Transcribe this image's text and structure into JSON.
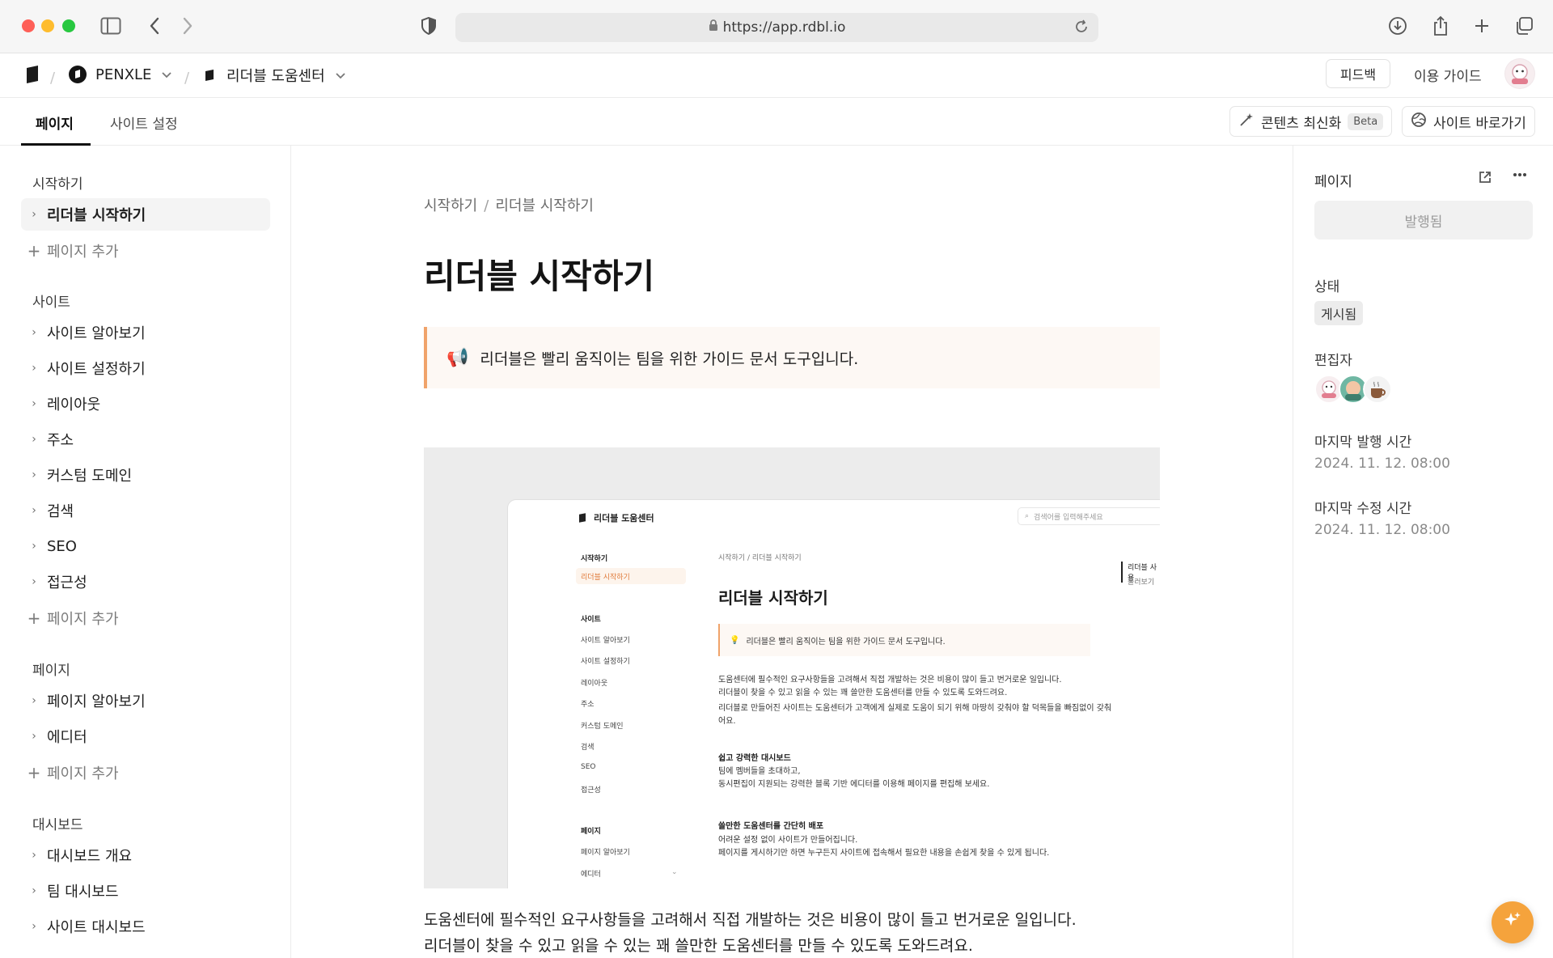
{
  "browser": {
    "url": "https://app.rdbl.io"
  },
  "appbar": {
    "workspace": "PENXLE",
    "site": "리더블 도움센터",
    "feedback_label": "피드백",
    "guide_label": "이용 가이드"
  },
  "tabs": [
    {
      "label": "페이지",
      "active": true
    },
    {
      "label": "사이트 설정",
      "active": false
    }
  ],
  "toolbar": {
    "refresh_label": "콘텐츠 최신화",
    "beta_label": "Beta",
    "visit_label": "사이트 바로가기"
  },
  "sidebar": {
    "sections": [
      {
        "title": "시작하기",
        "items": [
          "리더블 시작하기"
        ],
        "add_label": "페이지 추가"
      },
      {
        "title": "사이트",
        "items": [
          "사이트 알아보기",
          "사이트 설정하기",
          "레이아웃",
          "주소",
          "커스텀 도메인",
          "검색",
          "SEO",
          "접근성"
        ],
        "add_label": "페이지 추가"
      },
      {
        "title": "페이지",
        "items": [
          "페이지 알아보기",
          "에디터"
        ],
        "add_label": "페이지 추가"
      },
      {
        "title": "대시보드",
        "items": [
          "대시보드 개요",
          "팀 대시보드",
          "사이트 대시보드"
        ]
      }
    ]
  },
  "main": {
    "breadcrumb": [
      "시작하기",
      "리더블 시작하기"
    ],
    "title": "리더블 시작하기",
    "callout": "리더블은 빨리 움직이는 팀을 위한 가이드 문서 도구입니다.",
    "callout_emoji": "📢",
    "paragraphs": [
      "도움센터에 필수적인 요구사항들을 고려해서 직접 개발하는 것은 비용이 많이 들고 번거로운 일입니다.",
      "리더블이 찾을 수 있고 읽을 수 있는 꽤 쓸만한 도움센터를 만들 수 있도록 도와드려요."
    ],
    "screenshot": {
      "brand": "리더블 도움센터",
      "search_placeholder": "검색어를 입력해주세요",
      "nav": [
        {
          "label": "시작하기",
          "kind": "section"
        },
        {
          "label": "리더블 시작하기",
          "kind": "active"
        },
        {
          "label": "사이트",
          "kind": "section"
        },
        {
          "label": "사이트 알아보기",
          "kind": "item"
        },
        {
          "label": "사이트 설정하기",
          "kind": "item"
        },
        {
          "label": "레이아웃",
          "kind": "item"
        },
        {
          "label": "주소",
          "kind": "item"
        },
        {
          "label": "커스텀 도메인",
          "kind": "item"
        },
        {
          "label": "검색",
          "kind": "item"
        },
        {
          "label": "SEO",
          "kind": "item"
        },
        {
          "label": "접근성",
          "kind": "item"
        },
        {
          "label": "페이지",
          "kind": "section"
        },
        {
          "label": "페이지 알아보기",
          "kind": "item"
        },
        {
          "label": "에디터",
          "kind": "item"
        }
      ],
      "breadcrumb": "시작하기 / 리더블 시작하기",
      "title": "리더블 시작하기",
      "callout": "리더블은 빨리 움직이는 팀을 위한 가이드 문서 도구입니다.",
      "body": [
        {
          "text": "도움센터에 필수적인 요구사항들을 고려해서 직접 개발하는 것은 비용이 많이 들고 번거로운 일입니다.",
          "bold": false
        },
        {
          "text": "리더블이 찾을 수 있고 읽을 수 있는 꽤 쓸만한 도움센터를 만들 수 있도록 도와드려요.",
          "bold": false
        },
        {
          "text": "리더블로 만들어진 사이트는 도움센터가 고객에게 실제로 도움이 되기 위해 마땅히 갖춰야 할 덕목들을 빠짐없이 갖춰",
          "bold": false
        },
        {
          "text": "어요.",
          "bold": false
        },
        {
          "text": "쉽고 강력한 대시보드",
          "bold": true
        },
        {
          "text": "팀에 멤버들을 초대하고,",
          "bold": false
        },
        {
          "text": "동시편집이 지원되는 강력한 블록 기반 에디터를 이용해 페이지를 편집해 보세요.",
          "bold": false
        },
        {
          "text": "쓸만한 도움센터를 간단히 배포",
          "bold": true
        },
        {
          "text": "어려운 설정 없이 사이트가 만들어집니다.",
          "bold": false
        },
        {
          "text": "페이지를 게시하기만 하면 누구든지 사이트에 접속해서 필요한 내용을 손쉽게 찾을 수 있게 됩니다.",
          "bold": false
        }
      ],
      "toc": [
        "리더블 사용",
        "둘러보기"
      ]
    }
  },
  "rpanel": {
    "heading": "페이지",
    "publish_label": "발행됨",
    "status_label": "상태",
    "status_value": "게시됨",
    "editors_label": "편집자",
    "last_published_label": "마지막 발행 시간",
    "last_published_value": "2024. 11. 12. 08:00",
    "last_modified_label": "마지막 수정 시간",
    "last_modified_value": "2024. 11. 12. 08:00"
  },
  "icons": {
    "sidebar_toggle": "sidebar-icon",
    "back": "chevron-left-icon",
    "forward": "chevron-right-icon",
    "privacy": "shield-icon",
    "download": "download-icon",
    "share": "share-icon",
    "new_tab": "plus-icon",
    "tabs_overview": "tabs-icon",
    "fab": "sparkle-icon"
  },
  "colors": {
    "accent": "#f0a36a",
    "fab": "#f5a33c",
    "callout_bg": "#fdf8f4"
  }
}
